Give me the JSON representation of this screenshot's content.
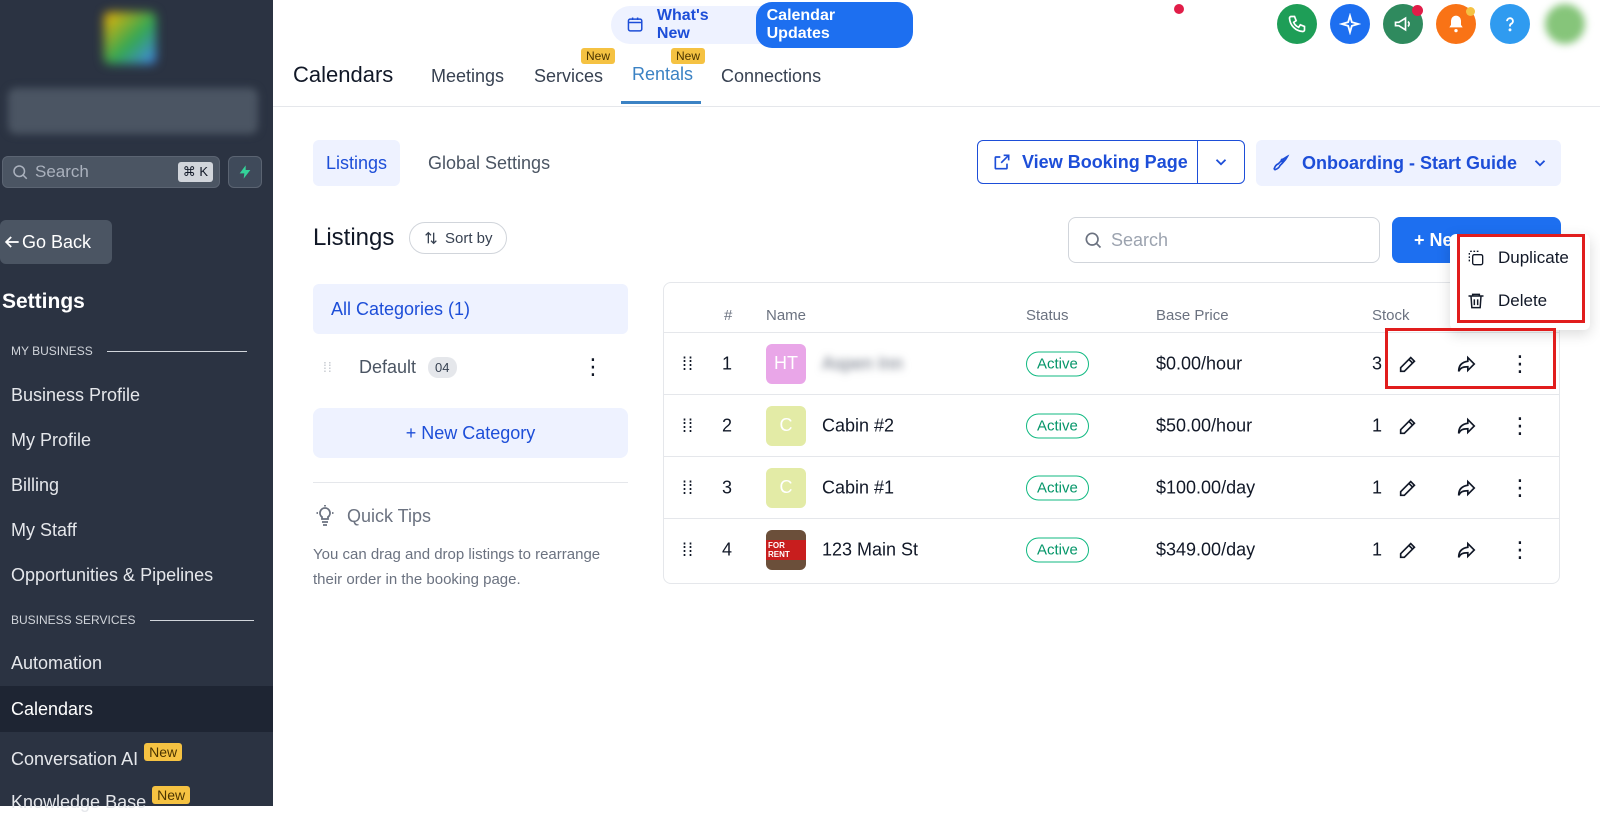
{
  "sidebar": {
    "search_placeholder": "Search",
    "search_shortcut": "⌘ K",
    "go_back": "Go Back",
    "settings_title": "Settings",
    "section_my_business": "MY BUSINESS",
    "section_business_services": "BUSINESS SERVICES",
    "items": [
      {
        "label": "Business Profile"
      },
      {
        "label": "My Profile"
      },
      {
        "label": "Billing"
      },
      {
        "label": "My Staff"
      },
      {
        "label": "Opportunities & Pipelines"
      },
      {
        "label": "Automation"
      },
      {
        "label": "Calendars"
      },
      {
        "label": "Conversation AI",
        "badge": "New"
      },
      {
        "label": "Knowledge Base",
        "badge": "New"
      }
    ],
    "active_item": "Calendars"
  },
  "topbar": {
    "whats_new": "What's New",
    "calendar_updates": "Calendar Updates",
    "icons": [
      "phone-icon",
      "sparkle-icon",
      "megaphone-icon",
      "bell-icon",
      "help-icon"
    ],
    "icon_colors": [
      "#1e9e57",
      "#1d6ff0",
      "#2f8a5e",
      "#f97316",
      "#2f9bf0"
    ]
  },
  "header": {
    "title": "Calendars",
    "tabs": [
      {
        "label": "Meetings"
      },
      {
        "label": "Services",
        "badge": "New"
      },
      {
        "label": "Rentals",
        "badge": "New"
      },
      {
        "label": "Connections"
      }
    ],
    "active_tab": "Rentals"
  },
  "subtabs": [
    {
      "label": "Listings"
    },
    {
      "label": "Global Settings"
    }
  ],
  "actions": {
    "view_booking_page": "View Booking Page",
    "onboarding": "Onboarding - Start Guide"
  },
  "listings": {
    "title": "Listings",
    "sort_by": "Sort by",
    "search_placeholder": "Search",
    "new_listing_visible": "+ Ne"
  },
  "categories": {
    "all": "All Categories (1)",
    "default_label": "Default",
    "default_count": "04",
    "new_category": "+ New Category"
  },
  "tips": {
    "title": "Quick Tips",
    "text": "You can drag and drop listings to rearrange their order in the booking page."
  },
  "table": {
    "headers": {
      "num": "#",
      "name": "Name",
      "status": "Status",
      "price": "Base Price",
      "stock": "Stock"
    },
    "rows": [
      {
        "num": "1",
        "thumb": "HT",
        "thumb_color": "#e9a6e8",
        "name": "Aspen Inn",
        "status": "Active",
        "price": "$0.00/hour",
        "stock": "3"
      },
      {
        "num": "2",
        "thumb": "C",
        "thumb_color": "#e3eba6",
        "name": "Cabin #2",
        "status": "Active",
        "price": "$50.00/hour",
        "stock": "1"
      },
      {
        "num": "3",
        "thumb": "C",
        "thumb_color": "#e3eba6",
        "name": "Cabin #1",
        "status": "Active",
        "price": "$100.00/day",
        "stock": "1"
      },
      {
        "num": "4",
        "thumb": "FOR RENT",
        "thumb_color": "#6b4f3a",
        "name": "123 Main St",
        "status": "Active",
        "price": "$349.00/day",
        "stock": "1"
      }
    ]
  },
  "menu": {
    "duplicate": "Duplicate",
    "delete": "Delete"
  },
  "colors": {
    "accent": "#1d6ff0",
    "sidebar_bg": "#2b3342",
    "active_green": "#10b981",
    "highlight": "#e11d1d"
  }
}
